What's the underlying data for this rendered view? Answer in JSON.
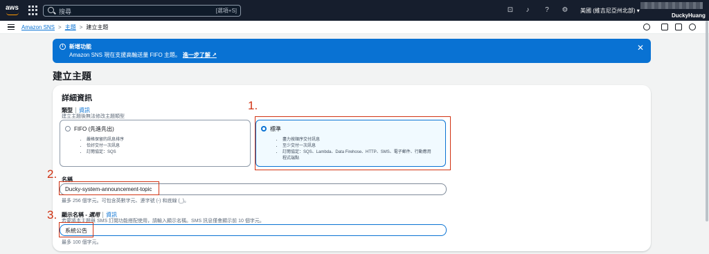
{
  "topnav": {
    "logo": "aws",
    "search_placeholder": "搜尋",
    "search_shortcut": "[選項+S]",
    "region": "美國 (維吉尼亞州北部) ▾",
    "user": "DuckyHuang",
    "icons": [
      "grid-icon",
      "search-icon",
      "terminal-icon",
      "bell-icon",
      "help-icon",
      "gear-icon"
    ]
  },
  "subnav": {
    "breadcrumbs": [
      "Amazon SNS",
      "主題",
      "建立主題"
    ],
    "separator": ">"
  },
  "banner": {
    "title": "新增功能",
    "text": "Amazon SNS 現在支援高輸送量 FIFO 主題。",
    "link": "進一步了解 ↗",
    "color": "#0972d3"
  },
  "page_title": "建立主題",
  "details": {
    "heading": "詳細資訊",
    "type": {
      "label": "類型",
      "info": "資訊",
      "description": "建立主題後無法修改主題類型",
      "options": [
        {
          "title": "FIFO (先進先出)",
          "selected": false,
          "bullets": [
            "嚴格保留的訊息排序",
            "恰好交付一次訊息",
            "訂閱協定：SQS"
          ]
        },
        {
          "title": "標準",
          "selected": true,
          "bullets": [
            "盡力按順序交付訊息",
            "至少交付一次訊息",
            "訂閱協定：SQS、Lambda、Data Firehose、HTTP、SMS、電子郵件、行動應用",
            "程式端點"
          ]
        }
      ]
    },
    "name": {
      "label": "名稱",
      "value": "Ducky-system-announcement-topic",
      "hint": "最多 256 個字元。可包含英數字元、連字號 (-) 和底線 (_)。"
    },
    "display_name": {
      "label": "顯示名稱 - ",
      "optional": "選用",
      "info": "資訊",
      "description": "若要將本主題與 SMS 訂閱功能搭配使用，請輸入顯示名稱。SMS 訊息僅會顯示前 10 個字元。",
      "value": "系統公告",
      "hint": "最多 100 個字元。"
    }
  },
  "annotations": [
    "1.",
    "2.",
    "3."
  ],
  "annotation_color": "#d13212"
}
